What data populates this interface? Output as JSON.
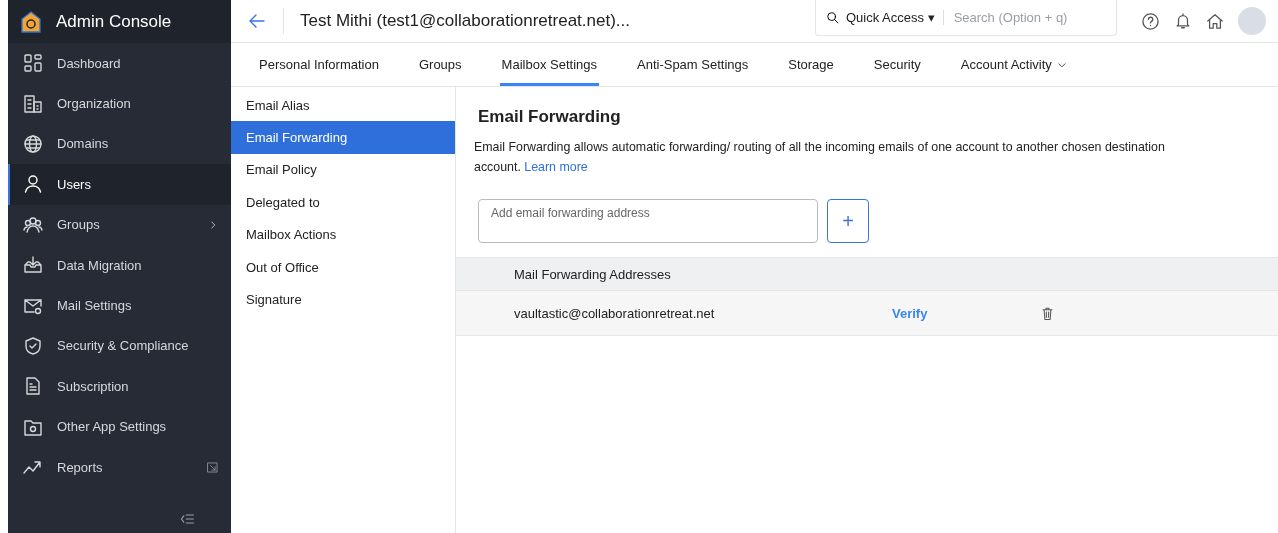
{
  "app": {
    "title": "Admin Console"
  },
  "sidebar": {
    "items": [
      {
        "label": "Dashboard",
        "selected": false
      },
      {
        "label": "Organization",
        "selected": false
      },
      {
        "label": "Domains",
        "selected": false
      },
      {
        "label": "Users",
        "selected": true
      },
      {
        "label": "Groups",
        "selected": false,
        "has_submenu": true
      },
      {
        "label": "Data Migration",
        "selected": false
      },
      {
        "label": "Mail Settings",
        "selected": false
      },
      {
        "label": "Security & Compliance",
        "selected": false
      },
      {
        "label": "Subscription",
        "selected": false
      },
      {
        "label": "Other App Settings",
        "selected": false
      },
      {
        "label": "Reports",
        "selected": false,
        "external": true
      }
    ]
  },
  "header": {
    "title": "Test Mithi (test1@collaborationretreat.net)...",
    "quick_access": "Quick Access ▾",
    "search": {
      "placeholder": "Search (Option + q)"
    }
  },
  "tabs": [
    {
      "label": "Personal Information",
      "selected": false
    },
    {
      "label": "Groups",
      "selected": false
    },
    {
      "label": "Mailbox Settings",
      "selected": true
    },
    {
      "label": "Anti-Spam Settings",
      "selected": false
    },
    {
      "label": "Storage",
      "selected": false
    },
    {
      "label": "Security",
      "selected": false
    },
    {
      "label": "Account Activity",
      "selected": false,
      "dropdown": true
    }
  ],
  "submenu": [
    {
      "label": "Email Alias",
      "selected": false
    },
    {
      "label": "Email Forwarding",
      "selected": true
    },
    {
      "label": "Email Policy",
      "selected": false
    },
    {
      "label": "Delegated to",
      "selected": false
    },
    {
      "label": "Mailbox Actions",
      "selected": false
    },
    {
      "label": "Out of Office",
      "selected": false
    },
    {
      "label": "Signature",
      "selected": false
    }
  ],
  "content": {
    "title": "Email Forwarding",
    "description": "Email Forwarding allows automatic forwarding/ routing of all the incoming emails of one account to another chosen destination account.",
    "link": "Learn more",
    "input": {
      "placeholder": "Add email forwarding address"
    },
    "add_button": "+",
    "table": {
      "columns": [
        "Mail Forwarding Addresses"
      ],
      "rows": [
        {
          "address": "vaultastic@collaborationretreat.net",
          "action": "Verify"
        }
      ]
    }
  }
}
